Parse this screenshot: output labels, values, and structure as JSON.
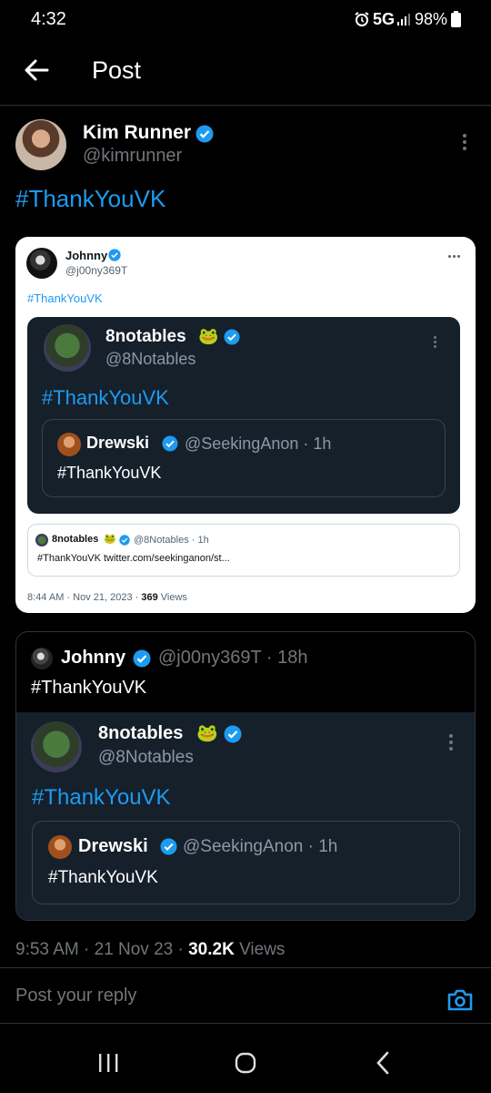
{
  "status_bar": {
    "time": "4:32",
    "network": "5G",
    "battery": "98%"
  },
  "header": {
    "title": "Post"
  },
  "post": {
    "author_name": "Kim Runner",
    "author_handle": "@kimrunner",
    "text": "#ThankYouVK",
    "timestamp": "9:53 AM · 21 Nov 23 · ",
    "views_count": "30.2K",
    "views_label": " Views"
  },
  "screenshot_card": {
    "author_name": "Johnny",
    "author_handle": "@j00ny369T",
    "text": "#ThankYouVK",
    "quote": {
      "author_name": "8notables",
      "emoji": "🐸",
      "author_handle": "@8Notables",
      "text": "#ThankYouVK",
      "inner": {
        "author_name": "Drewski",
        "meta": "@SeekingAnon · 1h",
        "text": "#ThankYouVK"
      }
    },
    "link_preview": {
      "author_name": "8notables",
      "emoji": "🐸",
      "meta": "@8Notables · 1h",
      "text": "#ThankYouVK twitter.com/seekinganon/st..."
    },
    "timestamp": "8:44 AM · Nov 21, 2023 · ",
    "views_count": "369",
    "views_label": " Views"
  },
  "quoted_post": {
    "author_name": "Johnny",
    "meta": "@j00ny369T · 18h",
    "text": "#ThankYouVK",
    "quote": {
      "author_name": "8notables",
      "emoji": "🐸",
      "author_handle": "@8Notables",
      "text": "#ThankYouVK",
      "inner": {
        "author_name": "Drewski",
        "meta": "@SeekingAnon · 1h",
        "text": "#ThankYouVK"
      }
    }
  },
  "reply": {
    "placeholder": "Post your reply"
  },
  "colors": {
    "accent": "#1d9bf0",
    "background": "#000000",
    "muted": "#71767b",
    "card_dark": "#15202b"
  },
  "icons": [
    "back-arrow-icon",
    "alarm-icon",
    "signal-icon",
    "battery-icon",
    "verified-icon",
    "more-icon",
    "camera-icon",
    "recents-icon",
    "home-icon",
    "nav-back-icon"
  ]
}
